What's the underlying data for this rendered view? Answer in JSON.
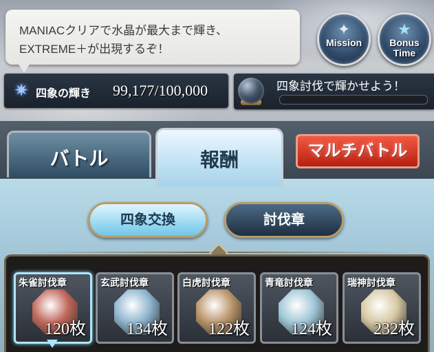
{
  "tip": {
    "line1": "MANIACクリアで水晶が最大まで輝き、",
    "line2": "EXTREME＋が出現するぞ！"
  },
  "buttons": {
    "mission_label": "Mission",
    "bonus_label_1": "Bonus",
    "bonus_label_2": "Time"
  },
  "kagayaki": {
    "label": "四象の輝き",
    "value": "99,177/100,000"
  },
  "orb": {
    "text": "四象討伐で輝かせよう！",
    "progress": 0
  },
  "tabs": {
    "battle": "バトル",
    "reward": "報酬",
    "multi": "マルチバトル",
    "active": "reward"
  },
  "subtabs": {
    "exchange": "四象交換",
    "medal": "討伐章",
    "active": "exchange"
  },
  "medals": [
    {
      "name": "朱雀討伐章",
      "count": "120枚",
      "color": "#c0675a",
      "selected": true
    },
    {
      "name": "玄武討伐章",
      "count": "134枚",
      "color": "#8fb5cf",
      "selected": false
    },
    {
      "name": "白虎討伐章",
      "count": "122枚",
      "color": "#b9956a",
      "selected": false
    },
    {
      "name": "青竜討伐章",
      "count": "124枚",
      "color": "#9fc7d6",
      "selected": false
    },
    {
      "name": "瑞神討伐章",
      "count": "232枚",
      "color": "#d8c9a4",
      "selected": false
    }
  ]
}
